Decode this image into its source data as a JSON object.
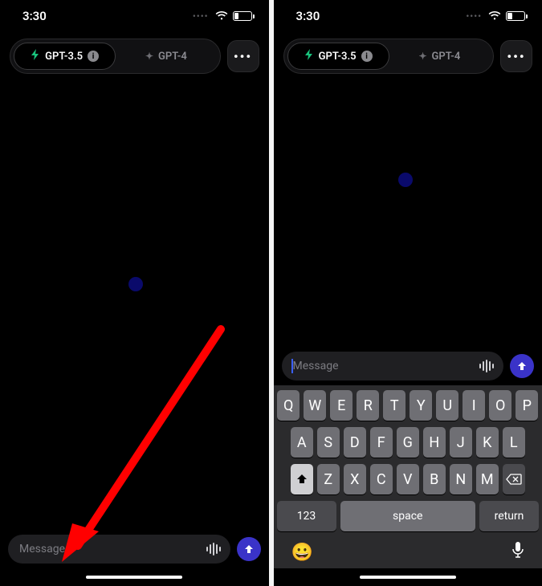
{
  "status": {
    "time": "3:30",
    "battery_pct": 27
  },
  "models": {
    "active": {
      "label": "GPT-3.5"
    },
    "inactive": {
      "label": "GPT-4"
    }
  },
  "menu": {
    "label": "•••"
  },
  "input": {
    "placeholder": "Message",
    "value": ""
  },
  "keyboard": {
    "row1": [
      "Q",
      "W",
      "E",
      "R",
      "T",
      "Y",
      "U",
      "I",
      "O",
      "P"
    ],
    "row2": [
      "A",
      "S",
      "D",
      "F",
      "G",
      "H",
      "J",
      "K",
      "L"
    ],
    "row3": [
      "Z",
      "X",
      "C",
      "V",
      "B",
      "N",
      "M"
    ],
    "numbers": "123",
    "space": "space",
    "return": "return"
  },
  "icons": {
    "bolt": "bolt-icon",
    "sparkle": "sparkle-icon",
    "info": "i",
    "waveform": "waveform-icon",
    "send": "arrow-up-icon",
    "emoji": "😀",
    "mic": "mic-icon",
    "shift": "shift-icon",
    "backspace": "backspace-icon"
  },
  "colors": {
    "accent_green": "#19c37d",
    "accent_blue": "#3a33c8",
    "arrow_red": "#ff0000"
  }
}
